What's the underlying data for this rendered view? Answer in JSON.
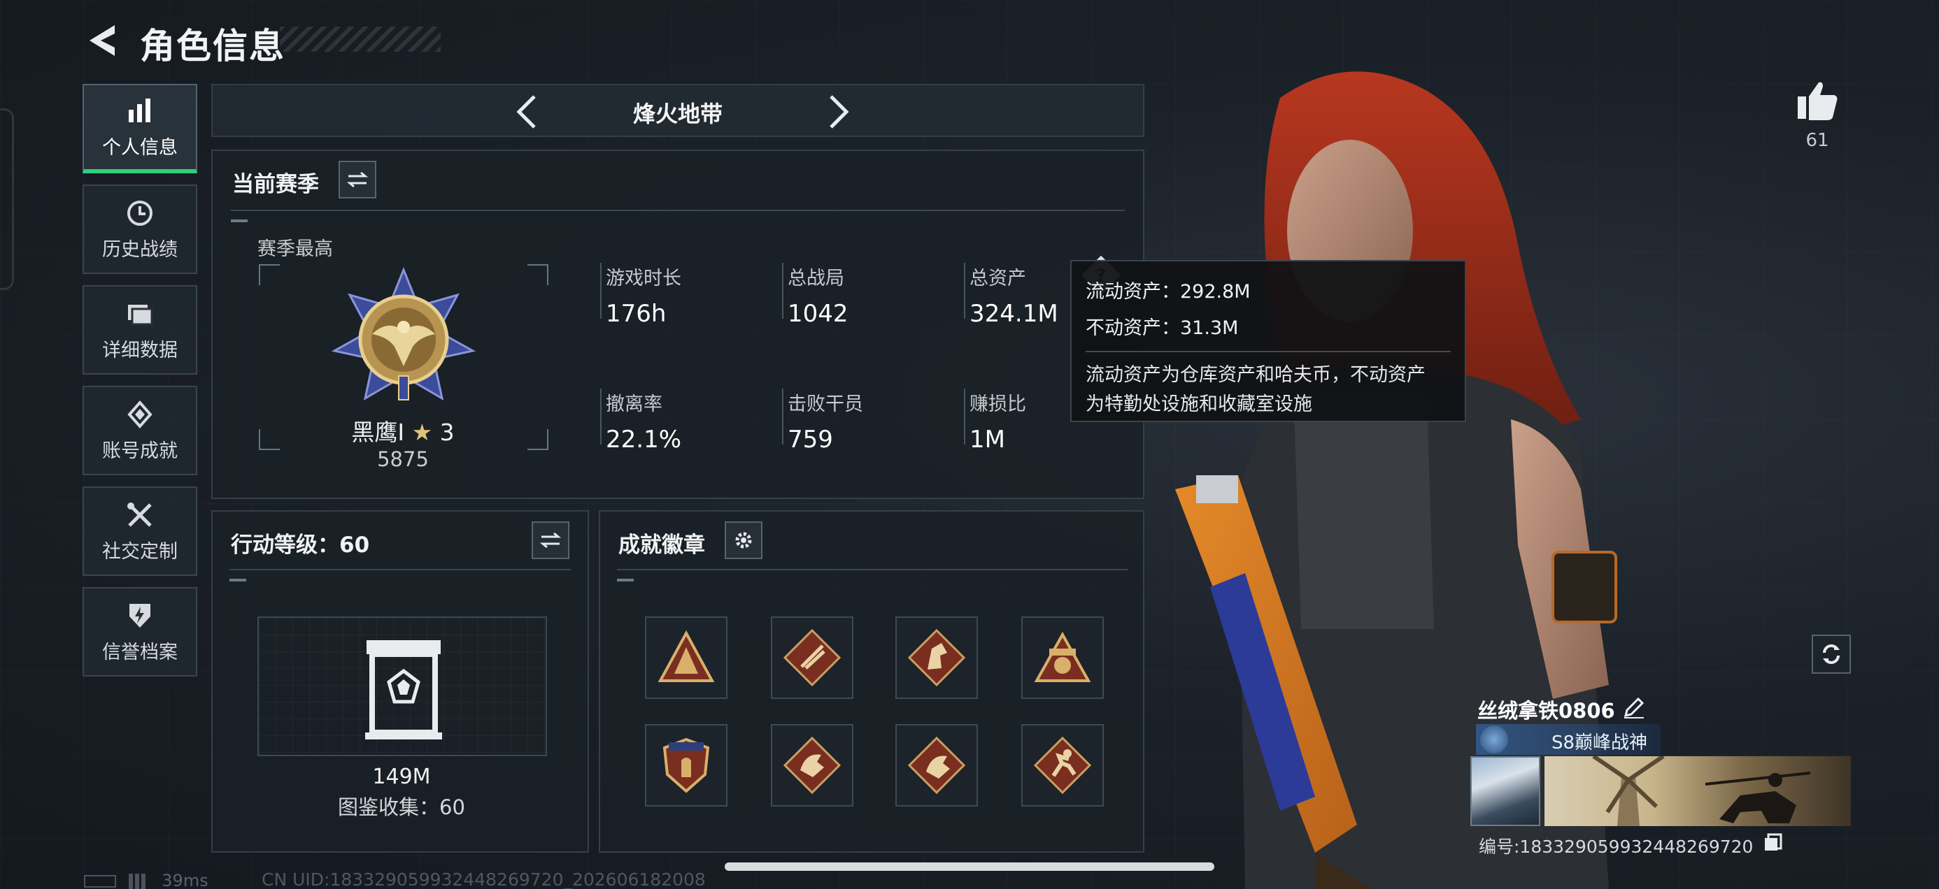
{
  "header": {
    "title": "角色信息"
  },
  "nav": [
    {
      "label": "个人信息",
      "icon": "bar-chart-icon",
      "active": true
    },
    {
      "label": "历史战绩",
      "icon": "history-clock-icon",
      "active": false
    },
    {
      "label": "详细数据",
      "icon": "folder-icon",
      "active": false
    },
    {
      "label": "账号成就",
      "icon": "achievement-icon",
      "active": false
    },
    {
      "label": "社交定制",
      "icon": "tools-icon",
      "active": false
    },
    {
      "label": "信誉档案",
      "icon": "shield-bolt-icon",
      "active": false
    }
  ],
  "mode": {
    "label": "烽火地带"
  },
  "season": {
    "title": "当前赛季",
    "best_label": "赛季最高",
    "rank_name": "黑鹰Ⅰ",
    "rank_stars": "3",
    "rank_score": "5875",
    "stats": [
      {
        "label": "游戏时长",
        "value": "176h"
      },
      {
        "label": "总战局",
        "value": "1042"
      },
      {
        "label": "总资产",
        "value": "324.1M"
      },
      {
        "label": "撤离率",
        "value": "22.1%"
      },
      {
        "label": "击败干员",
        "value": "759"
      },
      {
        "label": "赚损比",
        "value": "1M"
      }
    ]
  },
  "tooltip": {
    "liquid": "流动资产：292.8M",
    "fixed": "不动资产：31.3M",
    "desc_line1": "流动资产为仓库资产和哈夫币，不动资产",
    "desc_line2": "为特勤处设施和收藏室设施"
  },
  "level": {
    "title": "行动等级：60",
    "codex_value": "149M",
    "codex_label": "图鉴收集：60"
  },
  "badges": {
    "title": "成就徽章",
    "items": [
      "badge-1",
      "badge-2",
      "badge-3",
      "badge-4",
      "badge-5",
      "badge-6",
      "badge-7",
      "badge-8"
    ]
  },
  "profile": {
    "likes": "61",
    "name": "丝绒拿铁0806",
    "title_badge": "S8巅峰战神",
    "id_line": "编号:183329059932448269720"
  },
  "footer": {
    "ping": "39ms",
    "uid": "CN UID:183329059932448269720_202606182008"
  },
  "colors": {
    "accent_green": "#2fd07d",
    "badge_red": "#7a2e20",
    "badge_gold": "#c9a062"
  }
}
